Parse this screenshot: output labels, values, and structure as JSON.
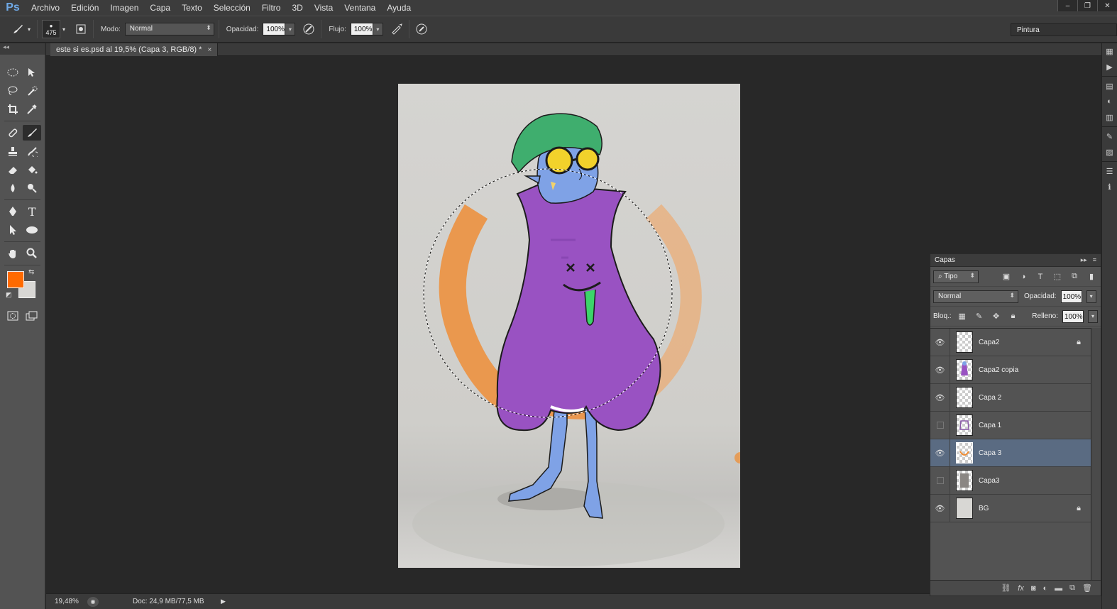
{
  "app": {
    "logo": "Ps"
  },
  "menu": [
    "Archivo",
    "Edición",
    "Imagen",
    "Capa",
    "Texto",
    "Selección",
    "Filtro",
    "3D",
    "Vista",
    "Ventana",
    "Ayuda"
  ],
  "window_controls": [
    "‒",
    "❐",
    "✕"
  ],
  "options": {
    "brush_size": "475",
    "mode_label": "Modo:",
    "mode_value": "Normal",
    "opacity_label": "Opacidad:",
    "opacity_value": "100%",
    "flow_label": "Flujo:",
    "flow_value": "100%",
    "workspace": "Pintura"
  },
  "document": {
    "tab_title": "este si es.psd al 19,5% (Capa 3, RGB/8) *",
    "close_glyph": "×"
  },
  "colors": {
    "foreground": "#ff6a00",
    "background": "#d8d7d4"
  },
  "status": {
    "zoom": "19,48%",
    "doc_info": "Doc: 24,9 MB/77,5 MB"
  },
  "layers_panel": {
    "tab": "Capas",
    "filter_kind": "Tipo",
    "blend_mode": "Normal",
    "opacity_label": "Opacidad:",
    "opacity_value": "100%",
    "lock_label": "Bloq.:",
    "fill_label": "Relleno:",
    "fill_value": "100%",
    "layers": [
      {
        "name": "Capa2",
        "visible": true,
        "locked": true,
        "selected": false
      },
      {
        "name": "Capa2 copia",
        "visible": true,
        "locked": false,
        "selected": false
      },
      {
        "name": "Capa 2",
        "visible": true,
        "locked": false,
        "selected": false
      },
      {
        "name": "Capa 1",
        "visible": false,
        "locked": false,
        "selected": false
      },
      {
        "name": "Capa 3",
        "visible": true,
        "locked": false,
        "selected": true
      },
      {
        "name": "Capa3",
        "visible": false,
        "locked": false,
        "selected": false
      },
      {
        "name": "BG",
        "visible": true,
        "locked": true,
        "selected": false
      }
    ]
  }
}
